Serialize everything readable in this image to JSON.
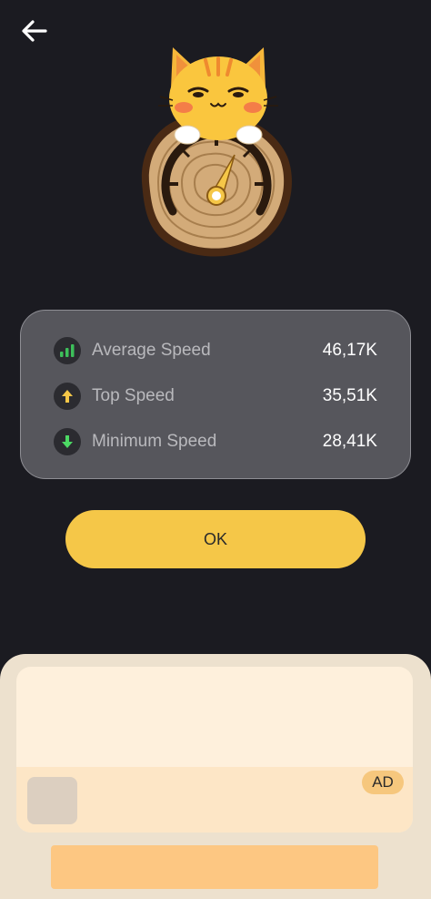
{
  "header": {
    "back_icon": "arrow-left-icon"
  },
  "hero": {
    "illustration": "cat-on-wooden-speedometer"
  },
  "stats": [
    {
      "label": "Average Speed",
      "value": "46,17K",
      "icon": "signal-bars-icon",
      "icon_color": "#3dbf5a"
    },
    {
      "label": "Top Speed",
      "value": "35,51K",
      "icon": "arrow-up-icon",
      "icon_color": "#f5c748"
    },
    {
      "label": "Minimum Speed",
      "value": "28,41K",
      "icon": "arrow-down-icon",
      "icon_color": "#4cd964"
    }
  ],
  "ok_button": {
    "label": "OK"
  },
  "ad": {
    "badge": "AD"
  },
  "colors": {
    "background": "#1b1b21",
    "accent": "#f5c748",
    "card": "#56565c",
    "ad_panel": "#ede1ce"
  }
}
